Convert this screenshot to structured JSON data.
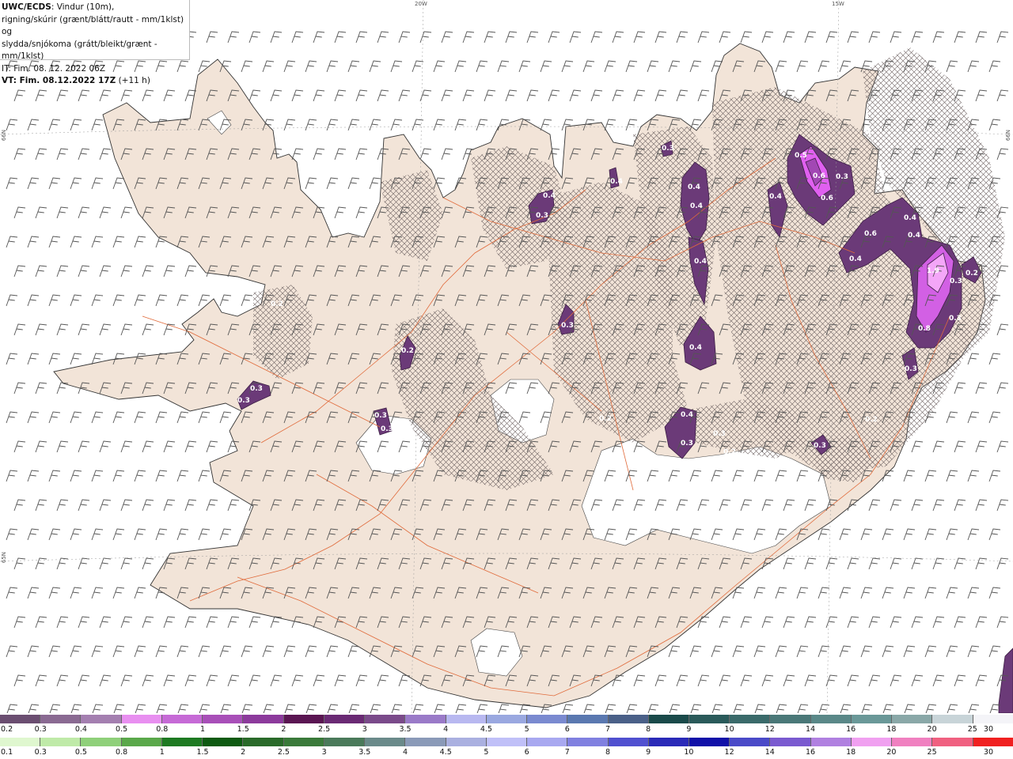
{
  "info": {
    "brand": "UWC/ECDS",
    "line1": ": Vindur (10m),",
    "line2": "rigning/skúrir (grænt/blátt/rautt - mm/1klst) og",
    "line3": "slydda/snjókoma (grátt/bleikt/grænt - mm/1klst)",
    "it": "IT: Fim. 08. 12. 2022 06Z",
    "vt_bold": "VT: Fim. 08.12.2022 17Z",
    "vt_rest": " (+11 h)"
  },
  "grid_labels": {
    "lon1": "20W",
    "lon2": "15W",
    "lat_left_top": "66N",
    "lat_left_mid": "65N",
    "lat_right_top": "66N"
  },
  "precip_labels": [
    {
      "t": "0.3"
    },
    {
      "t": "0.4"
    },
    {
      "t": "0.3"
    },
    {
      "t": "0.4"
    },
    {
      "t": "0.4"
    },
    {
      "t": "0.4"
    },
    {
      "t": "0.5"
    },
    {
      "t": "0.6"
    },
    {
      "t": "0.3"
    },
    {
      "t": "0.4"
    },
    {
      "t": "0.6"
    },
    {
      "t": "0.4"
    },
    {
      "t": "0.6"
    },
    {
      "t": "0.4"
    },
    {
      "t": "0.4"
    },
    {
      "t": "1.9"
    },
    {
      "t": "0.2"
    },
    {
      "t": "0.8"
    },
    {
      "t": "0.3"
    },
    {
      "t": "0.2"
    },
    {
      "t": "0.2"
    },
    {
      "t": "0.3"
    },
    {
      "t": "0.3"
    },
    {
      "t": "0.3"
    },
    {
      "t": "0.4"
    },
    {
      "t": "0.3"
    },
    {
      "t": "0.3"
    },
    {
      "t": "0.4"
    },
    {
      "t": "0.3"
    },
    {
      "t": "0.3"
    },
    {
      "t": "0.4"
    },
    {
      "t": "0.3"
    },
    {
      "t": "0.3"
    },
    {
      "t": "0.2"
    },
    {
      "t": "0.2"
    },
    {
      "t": "0.3"
    },
    {
      "t": "0.2"
    }
  ],
  "legend": {
    "snow": {
      "colors": [
        "#6b4e71",
        "#8a6a92",
        "#a47fb0",
        "#e88ff0",
        "#c66ad6",
        "#a84fb8",
        "#8c3a9c",
        "#5a1552",
        "#6a2a74",
        "#7a4a8a",
        "#9a7ac8",
        "#b8b8f0",
        "#9aa8e0",
        "#7a8ad0",
        "#5a78b0",
        "#4a6088",
        "#1a4a4a",
        "#2a5a5a",
        "#3a6a6a",
        "#4a7878",
        "#5a8888",
        "#6a9898",
        "#8aa8a8",
        "#c8d4d8",
        "#f4f4f8"
      ],
      "labels": [
        "0.2",
        "0.3",
        "0.4",
        "0.5",
        "0.8",
        "1",
        "1.5",
        "2",
        "2.5",
        "3",
        "3.5",
        "4",
        "4.5",
        "5",
        "6",
        "7",
        "8",
        "9",
        "10",
        "12",
        "14",
        "16",
        "18",
        "20",
        "25",
        "30"
      ]
    },
    "rain": {
      "colors": [
        "#dff7cf",
        "#bfeaa8",
        "#8fd07a",
        "#5aa84a",
        "#1e7a22",
        "#0e5a12",
        "#2a6a2a",
        "#3a7a3a",
        "#4a7a5a",
        "#6a8a8a",
        "#8a9ab8",
        "#aab0e0",
        "#c0c0f8",
        "#a8a8f0",
        "#8080e0",
        "#5050d0",
        "#2a2ab8",
        "#1010a8",
        "#4a4ac8",
        "#7a5ad0",
        "#b080e0",
        "#f0a0f0",
        "#f080c0",
        "#f06080",
        "#f02020"
      ],
      "labels": [
        "0.1",
        "0.3",
        "0.5",
        "0.8",
        "1",
        "1.5",
        "2",
        "2.5",
        "3",
        "3.5",
        "4",
        "4.5",
        "5",
        "6",
        "7",
        "8",
        "9",
        "10",
        "12",
        "14",
        "16",
        "18",
        "20",
        "25",
        "30"
      ]
    }
  }
}
